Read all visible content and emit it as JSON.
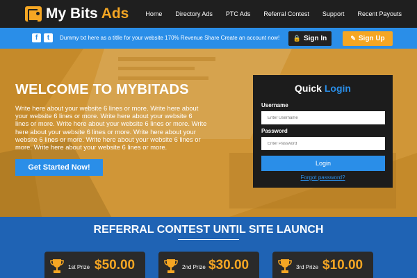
{
  "logo": {
    "part1": "My Bits",
    "part2": "Ads"
  },
  "nav": {
    "items": [
      "Home",
      "Directory Ads",
      "PTC Ads",
      "Referral Contest",
      "Support",
      "Recent Payouts"
    ]
  },
  "infobar": {
    "ticker": "Dummy txt here as a titlle for your website 170% Revenue Share Create an account now!",
    "signin_label": "Sign In",
    "signup_label": "Sign Up",
    "social": [
      "f",
      "t"
    ]
  },
  "hero": {
    "title": "WELCOME TO MYBITADS",
    "paragraph": "Write here about your website 6 lines or more. Write here about your website 6 lines or more. Write here about your website 6 lines or more. Write here about your website 6 lines or more. Write here about your website 6 lines or more. Write here about your website 6 lines or more. Write here about your website 6 lines or more. Write here about your website 6 lines or more.",
    "cta_label": "Get Started Now!"
  },
  "login": {
    "title_part1": "Quick",
    "title_part2": "Login",
    "username_label": "Username",
    "username_placeholder": "Enter Username",
    "password_label": "Password",
    "password_placeholder": "Enter Password",
    "button_label": "Login",
    "forgot_label": "Forgot password?"
  },
  "referral": {
    "title": "REFERRAL CONTEST UNTIL SITE LAUNCH",
    "prizes": [
      {
        "label": "1st Prize",
        "amount": "$50.00"
      },
      {
        "label": "2nd Prize",
        "amount": "$30.00"
      },
      {
        "label": "3rd Prize",
        "amount": "$10.00"
      }
    ]
  },
  "colors": {
    "accent_blue": "#2a8ee8",
    "accent_orange": "#f5a623",
    "dark": "#1f1f1f"
  }
}
